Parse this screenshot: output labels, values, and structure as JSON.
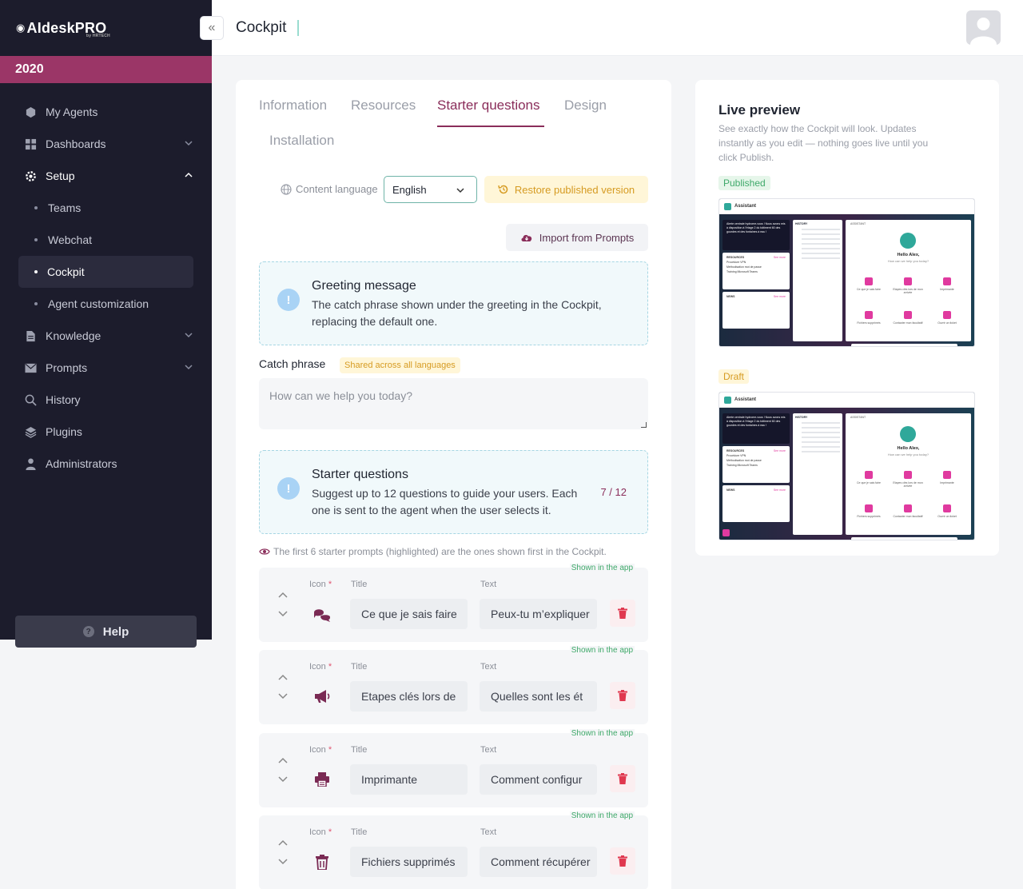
{
  "brand": {
    "name": "AIdeskPRO",
    "by": "by HRTECH"
  },
  "year": "2020",
  "sidebar": {
    "items": [
      {
        "label": "My Agents",
        "icon": "agents-icon"
      },
      {
        "label": "Dashboards",
        "icon": "dashboard-icon",
        "expandable": true
      },
      {
        "label": "Setup",
        "icon": "gear-icon",
        "expanded": true,
        "active": true
      },
      {
        "label": "Knowledge",
        "icon": "document-icon",
        "expandable": true
      },
      {
        "label": "Prompts",
        "icon": "envelope-icon",
        "expandable": true
      },
      {
        "label": "History",
        "icon": "search-icon"
      },
      {
        "label": "Plugins",
        "icon": "layers-icon"
      },
      {
        "label": "Administrators",
        "icon": "user-icon"
      }
    ],
    "setup_children": [
      {
        "label": "Teams"
      },
      {
        "label": "Webchat"
      },
      {
        "label": "Cockpit",
        "active": true
      },
      {
        "label": "Agent customization"
      }
    ],
    "help_label": "Help"
  },
  "header": {
    "title": "Cockpit"
  },
  "tabs": [
    {
      "label": "Information"
    },
    {
      "label": "Resources"
    },
    {
      "label": "Starter questions",
      "active": true
    },
    {
      "label": "Design"
    },
    {
      "label": "Installation"
    }
  ],
  "content_language": {
    "label": "Content language",
    "value": "English"
  },
  "restore_label": "Restore published version",
  "import_label": "Import from Prompts",
  "greeting_box": {
    "title": "Greeting message",
    "text_line1": "The catch phrase shown under the greeting in the Cockpit,",
    "text_line2": "replacing the default one."
  },
  "catch_phrase": {
    "label": "Catch phrase",
    "badge": "Shared across all languages",
    "placeholder": "How can we help you today?"
  },
  "starter_box": {
    "title": "Starter questions",
    "text_line1": "Suggest up to 12 questions to guide your users. Each",
    "text_line2": "one is sent to the agent when the user selects it.",
    "count": "7 / 12"
  },
  "hint": "The first 6 starter prompts (highlighted) are the ones shown first in the Cockpit.",
  "column_labels": {
    "icon": "Icon",
    "required": "*",
    "title": "Title",
    "text": "Text",
    "shown": "Shown in the app"
  },
  "questions": [
    {
      "icon": "chat-bubbles-icon",
      "title": "Ce que je sais faire",
      "text": "Peux-tu m’expliquer"
    },
    {
      "icon": "megaphone-icon",
      "title": "Etapes clés lors de",
      "text": "Quelles sont les ét"
    },
    {
      "icon": "printer-icon",
      "title": "Imprimante",
      "text": "Comment configur"
    },
    {
      "icon": "trash-icon",
      "title": "Fichiers supprimés",
      "text": "Comment récupérer"
    }
  ],
  "preview": {
    "title": "Live preview",
    "desc_line1": "See exactly how the Cockpit will look. Updates",
    "desc_line2": "instantly as you edit — nothing goes live until you",
    "desc_line3": "click Publish.",
    "published_label": "Published",
    "draft_label": "Draft",
    "mock": {
      "app_name": "Assistant",
      "alert": "Alerte centrale hydrome-vous ! Nous avons mis à disposition à l'étage 2 du bâtiment 60 des gourdes et des fontaines à eau !",
      "resources": "RESOURCES",
      "see_more": "See more",
      "res1": "Procédure VPN",
      "res2": "Méthodisation mot de passe",
      "res3": "Training Microsoft Teams",
      "news": "NEWS",
      "history": "HISTORY",
      "assistant": "ASSISTANT",
      "hello": "Hello Alex,",
      "help": "How can we help you today?",
      "tiles": [
        "Ce que je sais faire",
        "Etapes clés lors de mon arrivée",
        "Imprimante",
        "Fichiers supprimés",
        "Contacter mon facultatif",
        "Ouvrir un ticket"
      ]
    }
  },
  "colors": {
    "accent": "#8a2d5a",
    "sidebar_bg": "#1c1c2c",
    "year_bar": "#9b3667",
    "success": "#3fa96a",
    "warning": "#d69b22",
    "danger": "#e0384f"
  }
}
